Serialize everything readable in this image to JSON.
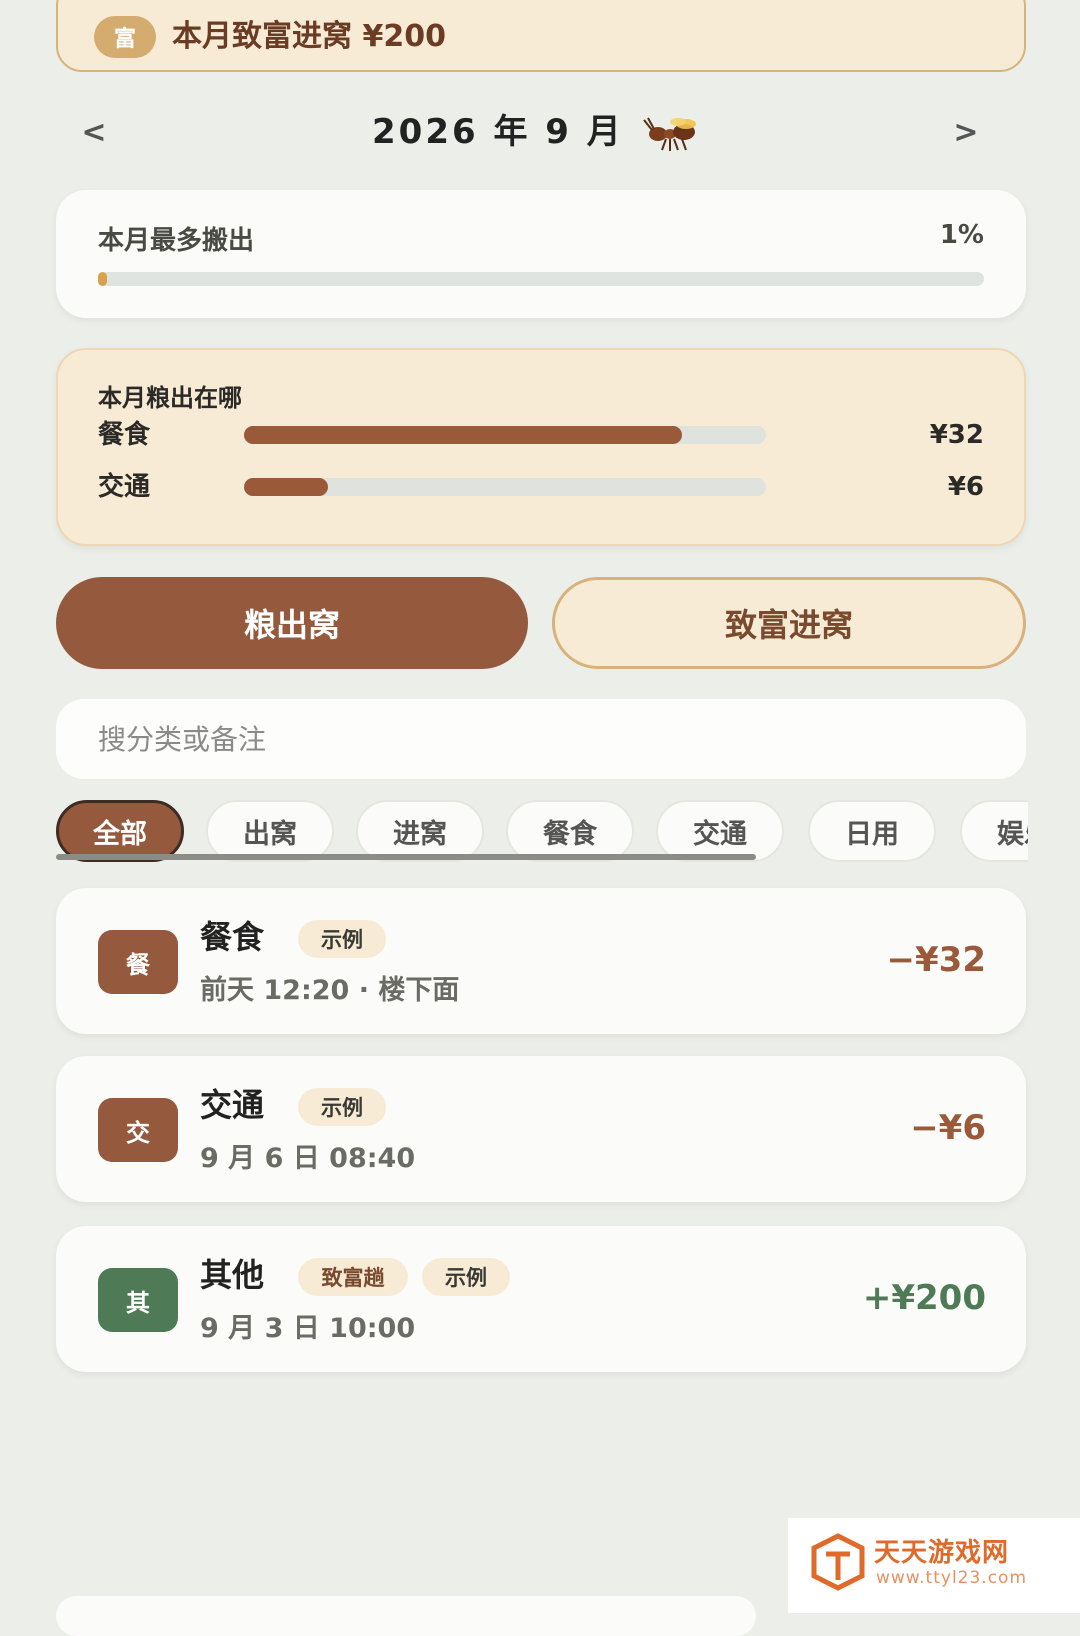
{
  "banner": {
    "badge": "富",
    "text": "本月致富进窝 ¥200"
  },
  "month_nav": {
    "prev": "<",
    "title": "2026 年 9 月",
    "next": ">",
    "mascot": "ant-icon"
  },
  "top_out": {
    "label": "本月最多搬出",
    "percent": "1%",
    "fill_fraction": 0.01
  },
  "breakdown": {
    "title": "本月粮出在哪",
    "rows": [
      {
        "label": "餐食",
        "value": "¥32",
        "fill_fraction": 0.84
      },
      {
        "label": "交通",
        "value": "¥6",
        "fill_fraction": 0.16
      }
    ]
  },
  "actions": {
    "out_label": "粮出窝",
    "in_label": "致富进窝"
  },
  "search": {
    "placeholder": "搜分类或备注",
    "value": ""
  },
  "chips": [
    "全部",
    "出窝",
    "进窝",
    "餐食",
    "交通",
    "日用",
    "娱乐"
  ],
  "active_chip": "全部",
  "transactions": [
    {
      "icon_text": "餐",
      "title": "餐食",
      "tags": [
        "示例"
      ],
      "subtitle": "前天 12:20 · 楼下面",
      "amount": "−¥32",
      "type": "expense"
    },
    {
      "icon_text": "交",
      "title": "交通",
      "tags": [
        "示例"
      ],
      "subtitle": "9 月 6 日 08:40",
      "amount": "−¥6",
      "type": "expense"
    },
    {
      "icon_text": "其",
      "title": "其他",
      "tags": [
        "致富趟",
        "示例"
      ],
      "subtitle": "9 月 3 日 10:00",
      "amount": "+¥200",
      "type": "income"
    }
  ],
  "colors": {
    "expense": "#9a5a3a",
    "income": "#4e7a55",
    "accent": "#955a3d",
    "gold": "#d7b27a"
  },
  "watermark": {
    "name": "天天游戏网",
    "url": "www.ttyl23.com"
  }
}
